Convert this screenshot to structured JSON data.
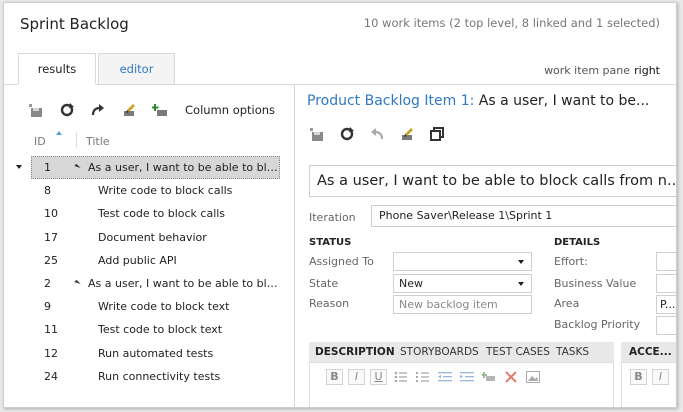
{
  "page": {
    "title": "Sprint Backlog",
    "summary": "10 work items (2 top level, 8 linked and 1 selected)"
  },
  "tabs": [
    {
      "label": "results",
      "active": true
    },
    {
      "label": "editor",
      "active": false
    }
  ],
  "work_item_pane": {
    "label": "work item pane",
    "value": "right"
  },
  "left_toolbar": {
    "icons": [
      "save-icon",
      "refresh-icon",
      "redo-icon",
      "edit-query-icon",
      "add-link-icon"
    ],
    "column_options_label": "Column options"
  },
  "grid": {
    "columns": {
      "id": "ID",
      "title": "Title"
    },
    "rows": [
      {
        "id": "1",
        "title": "As a user, I want to be able to block...",
        "level": "top",
        "selected": true
      },
      {
        "id": "8",
        "title": "Write code to block calls",
        "level": "child",
        "selected": false
      },
      {
        "id": "10",
        "title": "Test code to block calls",
        "level": "child",
        "selected": false
      },
      {
        "id": "17",
        "title": "Document behavior",
        "level": "child",
        "selected": false
      },
      {
        "id": "25",
        "title": "Add public API",
        "level": "child",
        "selected": false
      },
      {
        "id": "2",
        "title": "As a user, I want to be able to block...",
        "level": "top",
        "selected": false
      },
      {
        "id": "9",
        "title": "Write code to block text",
        "level": "child",
        "selected": false
      },
      {
        "id": "11",
        "title": "Test code to block text",
        "level": "child",
        "selected": false
      },
      {
        "id": "12",
        "title": "Run automated tests",
        "level": "child",
        "selected": false
      },
      {
        "id": "24",
        "title": "Run connectivity tests",
        "level": "child",
        "selected": false
      }
    ]
  },
  "work_item": {
    "type_label": "Product Backlog Item 1:",
    "header_title": "As a user, I want to be...",
    "toolbar_icons": [
      "save-icon",
      "refresh-icon",
      "undo-icon",
      "edit-icon",
      "copy-icon"
    ],
    "title_value": "As a user, I want to be able to block calls from n...",
    "iteration_label": "Iteration",
    "iteration_value": "Phone Saver\\Release 1\\Sprint 1",
    "status": {
      "heading": "STATUS",
      "assigned_to_label": "Assigned To",
      "assigned_to_value": "",
      "state_label": "State",
      "state_value": "New",
      "reason_label": "Reason",
      "reason_placeholder": "New backlog item"
    },
    "details": {
      "heading": "DETAILS",
      "effort_label": "Effort:",
      "business_value_label": "Business Value",
      "area_label": "Area",
      "area_value": "P...",
      "backlog_priority_label": "Backlog Priority"
    },
    "lower_tabs": [
      "DESCRIPTION",
      "STORYBOARDS",
      "TEST CASES",
      "TASKS"
    ],
    "acceptance_tab": "ACCE...",
    "format_buttons": {
      "bold": "B",
      "italic": "I",
      "underline": "U"
    }
  },
  "colors": {
    "accent_blue": "#2f79c0",
    "selected_row": "#d7d7d7",
    "tab_strip": "#e8e8e8"
  }
}
